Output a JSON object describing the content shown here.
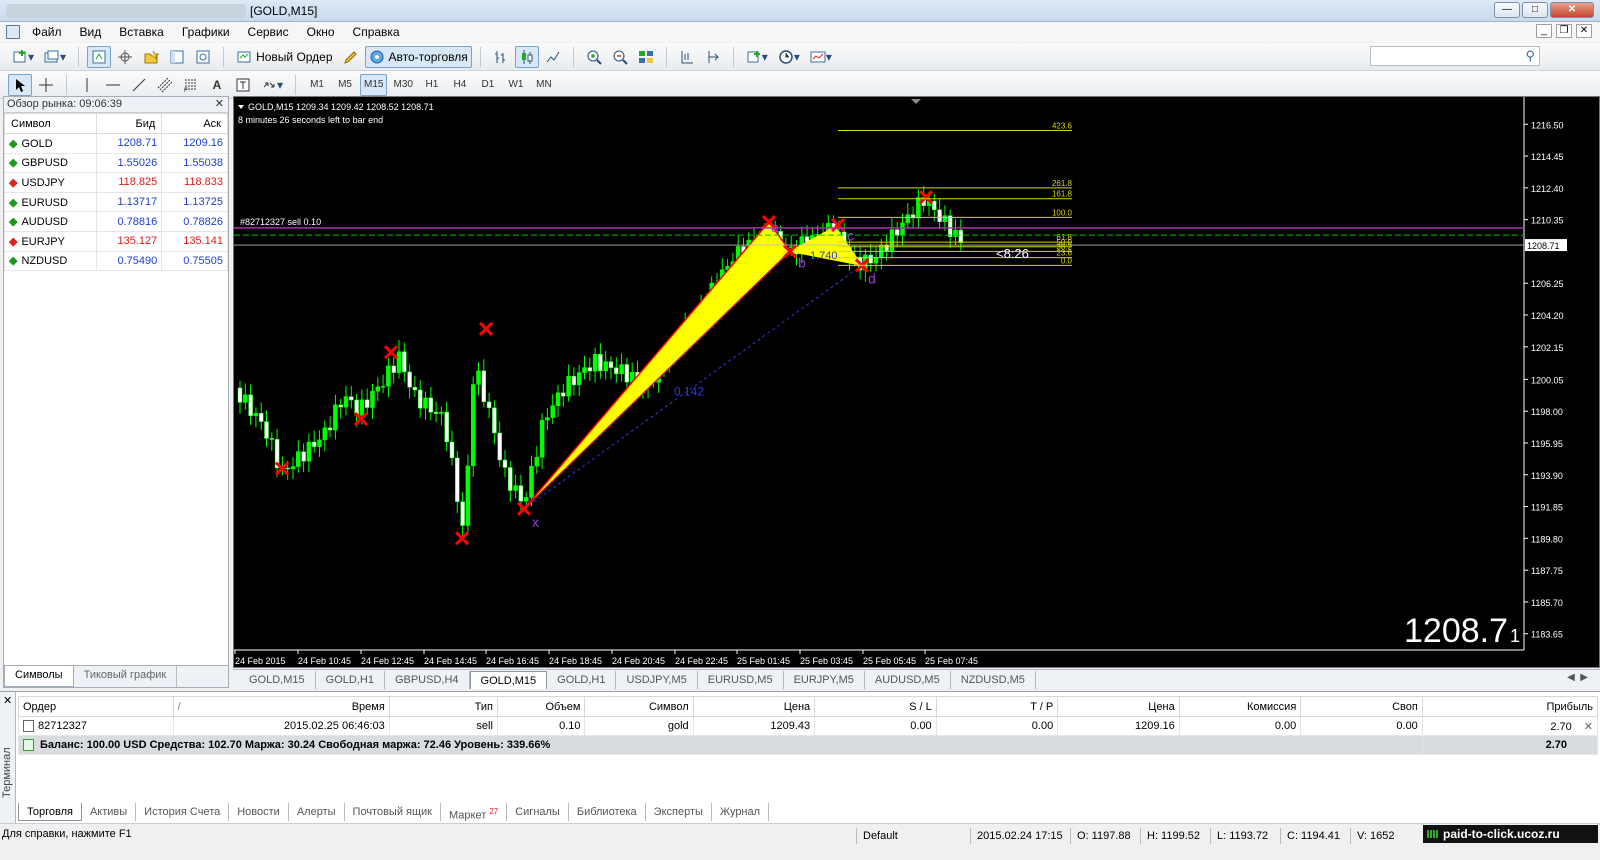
{
  "window": {
    "title": "[GOLD,M15]"
  },
  "menu": [
    "Файл",
    "Вид",
    "Вставка",
    "Графики",
    "Сервис",
    "Окно",
    "Справка"
  ],
  "toolbar": {
    "new_order": "Новый Ордер",
    "auto_trading": "Авто-торговля",
    "text_tool": "A"
  },
  "timeframes": [
    "M1",
    "M5",
    "M15",
    "M30",
    "H1",
    "H4",
    "D1",
    "W1",
    "MN"
  ],
  "active_timeframe": "M15",
  "market_watch": {
    "header": "Обзор рынка: 09:06:39",
    "columns": {
      "symbol": "Символ",
      "bid": "Бид",
      "ask": "Аск"
    },
    "rows": [
      {
        "symbol": "GOLD",
        "bid": "1208.71",
        "ask": "1209.16",
        "dir": "up",
        "color": "#1d3fd1"
      },
      {
        "symbol": "GBPUSD",
        "bid": "1.55026",
        "ask": "1.55038",
        "dir": "up",
        "color": "#1d3fd1"
      },
      {
        "symbol": "USDJPY",
        "bid": "118.825",
        "ask": "118.833",
        "dir": "down",
        "color": "#e01b1b"
      },
      {
        "symbol": "EURUSD",
        "bid": "1.13717",
        "ask": "1.13725",
        "dir": "up",
        "color": "#1d3fd1"
      },
      {
        "symbol": "AUDUSD",
        "bid": "0.78816",
        "ask": "0.78826",
        "dir": "up",
        "color": "#1d3fd1"
      },
      {
        "symbol": "EURJPY",
        "bid": "135.127",
        "ask": "135.141",
        "dir": "down",
        "color": "#e01b1b"
      },
      {
        "symbol": "NZDUSD",
        "bid": "0.75490",
        "ask": "0.75505",
        "dir": "up",
        "color": "#1d3fd1"
      }
    ],
    "tabs": [
      "Символы",
      "Тиковый график"
    ]
  },
  "chart": {
    "header": "GOLD,M15  1209.34 1209.42 1208.52 1208.71",
    "subheader": "8 minutes 26 seconds left to bar end",
    "order_label": "#82712327 sell 0.10",
    "countdown": "<8:26",
    "big_price": "1208.7",
    "big_price_small": "1",
    "current_price": "1208.71",
    "price_ticks": [
      "1216.50",
      "1214.45",
      "1212.40",
      "1210.35",
      "1208.71",
      "1206.25",
      "1204.20",
      "1202.15",
      "1200.05",
      "1198.00",
      "1195.95",
      "1193.90",
      "1191.85",
      "1189.80",
      "1187.75",
      "1185.70",
      "1183.65"
    ],
    "time_ticks": [
      "24 Feb 2015",
      "24 Feb 10:45",
      "24 Feb 12:45",
      "24 Feb 14:45",
      "24 Feb 16:45",
      "24 Feb 18:45",
      "24 Feb 20:45",
      "24 Feb 22:45",
      "25 Feb 01:45",
      "25 Feb 03:45",
      "25 Feb 05:45",
      "25 Feb 07:45"
    ],
    "fib_levels": [
      "423.6",
      "261.8",
      "161.8",
      "100.0",
      "61.8",
      "50.0",
      "38.2",
      "23.6",
      "0.0"
    ],
    "pattern_labels": {
      "x": "x",
      "a": "a",
      "b": "b",
      "c": "c",
      "d": "d",
      "ratio1": "0.142",
      "ratio2": "1.740"
    },
    "colors": {
      "bull": "#00ff00",
      "bear": "#ffffff",
      "pattern_fill": "#ffff00",
      "pattern_edge": "#ff0000",
      "marker": "#ff0000",
      "fib": "#d8d800",
      "order_line": "#b030b0",
      "bid_line": "#00c000"
    }
  },
  "chart_tabs": [
    "GOLD,M15",
    "GOLD,H1",
    "GBPUSD,H4",
    "GOLD,M15",
    "GOLD,H1",
    "USDJPY,M5",
    "EURUSD,M5",
    "EURJPY,M5",
    "AUDUSD,M5",
    "NZDUSD,M5"
  ],
  "chart_tabs_active_index": 3,
  "terminal": {
    "side_label": "Терминал",
    "columns": [
      "Ордер",
      "Время",
      "Тип",
      "Объем",
      "Символ",
      "Цена",
      "S / L",
      "T / P",
      "Цена",
      "Комиссия",
      "Своп",
      "Прибыль"
    ],
    "sort_indicator": "/",
    "order": {
      "id": "82712327",
      "time": "2015.02.25 06:46:03",
      "type": "sell",
      "volume": "0.10",
      "symbol": "gold",
      "price": "1209.43",
      "sl": "0.00",
      "tp": "0.00",
      "cur_price": "1209.16",
      "commission": "0.00",
      "swap": "0.00",
      "profit": "2.70"
    },
    "balance_line": "Баланс: 100.00 USD  Средства: 102.70  Маржа: 30.24  Свободная маржа: 72.46  Уровень: 339.66%",
    "balance_profit": "2.70",
    "tabs": [
      "Торговля",
      "Активы",
      "История Счета",
      "Новости",
      "Алерты",
      "Почтовый ящик",
      "Маркет",
      "Сигналы",
      "Библиотека",
      "Эксперты",
      "Журнал"
    ],
    "market_badge": "27"
  },
  "status": {
    "help": "Для справки, нажмите F1",
    "profile": "Default",
    "datetime": "2015.02.24 17:15",
    "open": "O: 1197.88",
    "high": "H: 1199.52",
    "low": "L: 1193.72",
    "close": "C: 1194.41",
    "volume": "V: 1652",
    "link": "paid-to-click.ucoz.ru"
  }
}
